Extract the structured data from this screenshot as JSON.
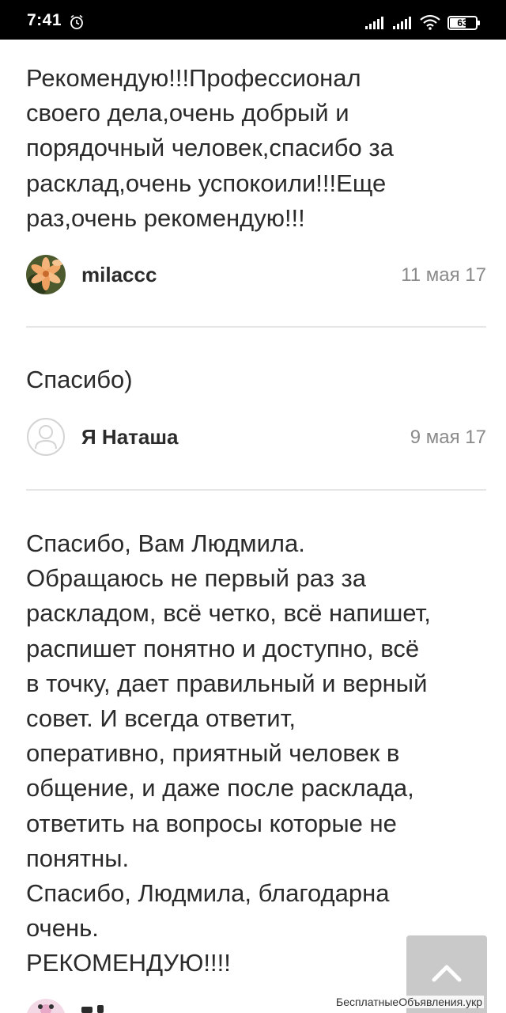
{
  "status_bar": {
    "time": "7:41",
    "battery_percent": 63,
    "battery_label": "63",
    "icons": [
      "alarm-icon",
      "cell-signal-icon",
      "cell-signal-icon",
      "wifi-icon",
      "battery-icon"
    ]
  },
  "reviews": [
    {
      "text": "Рекомендую!!!Профессионал\nсвоего дела,очень добрый и\nпорядочный человек,спасибо за\nрасклад,очень успокоили!!!Еще\nраз,очень рекомендую!!!",
      "author": "milaccc",
      "date": "11 мая 17",
      "avatar": "flower-photo"
    },
    {
      "text": "Спасибо)",
      "author": "Я Наташа",
      "date": "9 мая 17",
      "avatar": "default-user-icon"
    },
    {
      "text": "Спасибо, Вам Людмила.\nОбращаюсь не первый раз за\nраскладом, всё четко, всё напишет,\nраспишет понятно и доступно, всё\nв точку, дает правильный и верный\nсовет. И всегда ответит,\nоперативно, приятный человек в\nобщение, и даже после расклада,\nответить на вопросы которые не\nпонятны.\nСпасибо, Людмила, благодарна\nочень.\nРЕКОМЕНДУЮ!!!!"
    }
  ],
  "scroll_top": {
    "icon": "chevron-up-icon"
  },
  "watermark": "БесплатныеОбъявления.укр",
  "colors": {
    "status_bar_bg": "#000000",
    "text": "#2b2b2b",
    "date": "#8a8a8a",
    "divider": "#e6e6e6",
    "scroll_button": "#c9c9c9"
  }
}
